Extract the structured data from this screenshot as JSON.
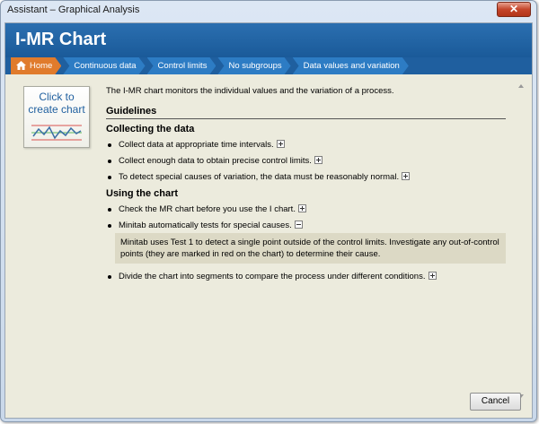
{
  "window": {
    "title": "Assistant – Graphical Analysis",
    "close_label": "✕"
  },
  "header": {
    "title": "I-MR Chart"
  },
  "breadcrumbs": [
    {
      "label": "Home"
    },
    {
      "label": "Continuous data"
    },
    {
      "label": "Control limits"
    },
    {
      "label": "No subgroups"
    },
    {
      "label": "Data values and variation"
    }
  ],
  "chart_button": {
    "line1": "Click to",
    "line2": "create chart"
  },
  "intro": "The I-MR chart monitors the individual values and the variation of a process.",
  "guidelines_title": "Guidelines",
  "collecting": {
    "title": "Collecting the data",
    "items": [
      {
        "text": "Collect data at appropriate time intervals."
      },
      {
        "text": "Collect enough data to obtain precise control limits."
      },
      {
        "text": "To detect special causes of variation, the data must be reasonably normal."
      }
    ]
  },
  "using": {
    "title": "Using the chart",
    "items": [
      {
        "text": "Check the MR chart before you use the I chart."
      },
      {
        "text": "Minitab automatically tests for special causes."
      },
      {
        "text": "Divide the chart into segments to compare the process under different conditions."
      }
    ],
    "expanded_text": "Minitab uses Test 1 to detect a single point outside of the control limits. Investigate any out-of-control points (they are marked in red on the chart) to determine their cause."
  },
  "footer": {
    "cancel_label": "Cancel"
  },
  "colors": {
    "header_blue": "#1a5a99",
    "breadcrumb_home": "#e07b2c",
    "background": "#ecebdd"
  }
}
